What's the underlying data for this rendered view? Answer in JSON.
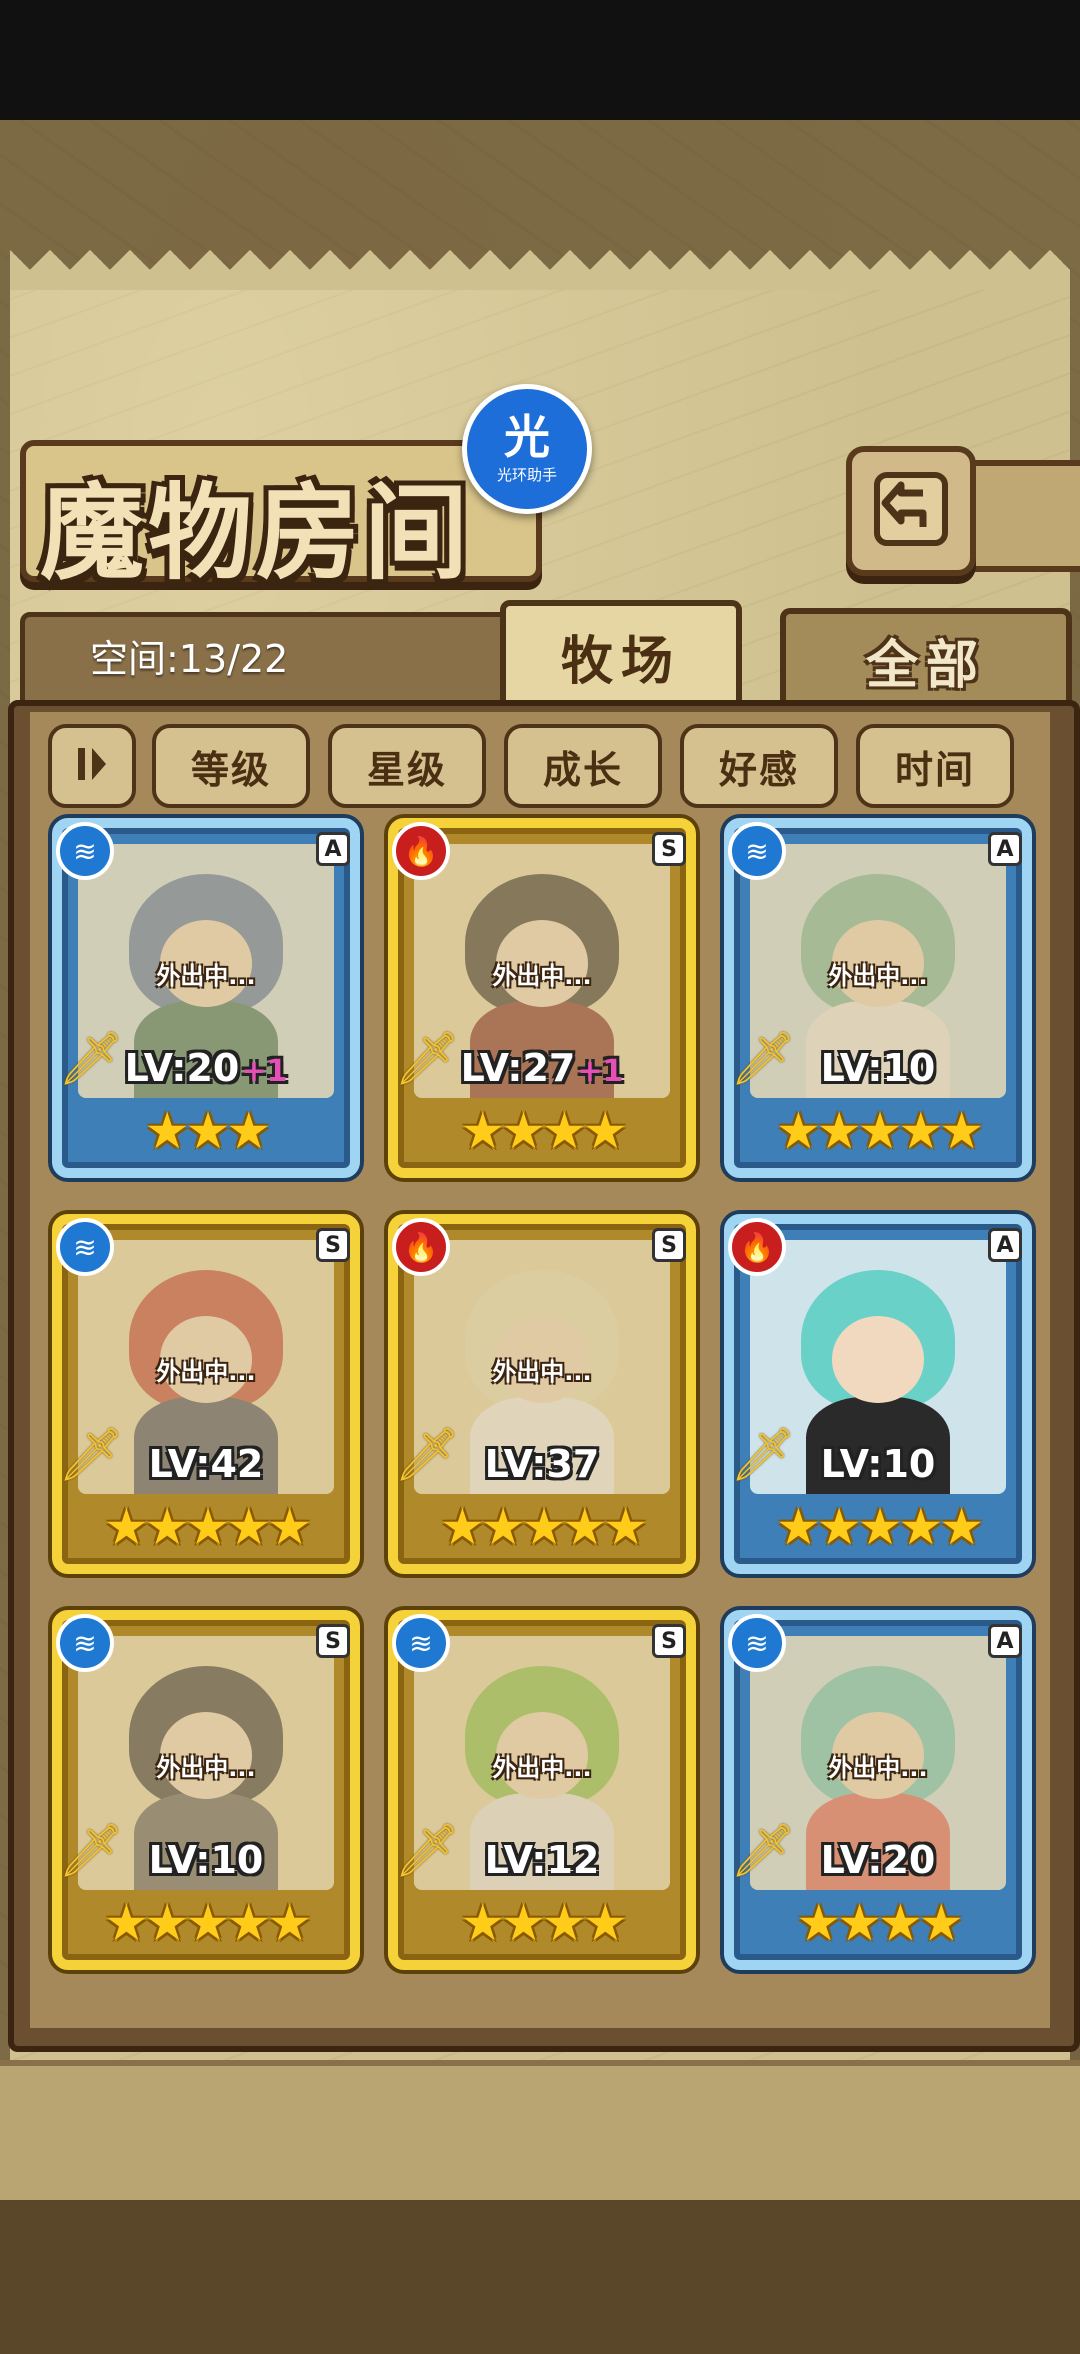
{
  "header": {
    "title": "魔物房间",
    "overlay_badge": {
      "glyph": "光",
      "caption": "光环助手"
    },
    "back_icon": "return-arrow-icon"
  },
  "space": {
    "label": "空间:13/22"
  },
  "tabs": [
    {
      "label": "牧场",
      "active": true
    },
    {
      "label": "全部",
      "active": false
    }
  ],
  "sort": {
    "toggle_icon": "sort-order-icon",
    "buttons": [
      "等级",
      "星级",
      "成长",
      "好感",
      "时间"
    ]
  },
  "status_text": "外出中...",
  "colors": {
    "blue_frame": "#9fd4f2",
    "gold_frame": "#f6d23a",
    "water": "#1f78d1",
    "fire": "#c81e1e",
    "plus": "#e64fb6"
  },
  "cards": [
    {
      "element": "water",
      "rank": "A",
      "frame": "blue",
      "level": "LV:20",
      "bonus": "+1",
      "stars": "★★★",
      "out": true,
      "hair": "#4d6fa8",
      "outfit": "#2f6b5a"
    },
    {
      "element": "fire",
      "rank": "S",
      "frame": "gold",
      "level": "LV:27",
      "bonus": "+1",
      "stars": "★★★★",
      "out": true,
      "hair": "#2b2420",
      "outfit": "#7a1c14"
    },
    {
      "element": "water",
      "rank": "A",
      "frame": "blue",
      "level": "LV:10",
      "bonus": "",
      "stars": "★★★★★",
      "out": true,
      "hair": "#6fb7a0",
      "outfit": "#eeeeee"
    },
    {
      "element": "water",
      "rank": "S",
      "frame": "gold",
      "level": "LV:42",
      "bonus": "",
      "stars": "★★★★★",
      "out": true,
      "hair": "#c0392b",
      "outfit": "#3a3f55"
    },
    {
      "element": "fire",
      "rank": "S",
      "frame": "gold",
      "level": "LV:37",
      "bonus": "",
      "stars": "★★★★★",
      "out": true,
      "hair": "#e9dfb8",
      "outfit": "#f2f2f2"
    },
    {
      "element": "fire",
      "rank": "A",
      "frame": "blue",
      "level": "LV:10",
      "bonus": "",
      "stars": "★★★★★",
      "out": false,
      "hair": "#6ad1c8",
      "outfit": "#2a2a2a"
    },
    {
      "element": "water",
      "rank": "S",
      "frame": "gold",
      "level": "LV:10",
      "bonus": "",
      "stars": "★★★★★",
      "out": true,
      "hair": "#2e2e2e",
      "outfit": "#555555"
    },
    {
      "element": "water",
      "rank": "S",
      "frame": "gold",
      "level": "LV:12",
      "bonus": "",
      "stars": "★★★★",
      "out": true,
      "hair": "#7fbf3f",
      "outfit": "#e8e8e8"
    },
    {
      "element": "water",
      "rank": "A",
      "frame": "blue",
      "level": "LV:20",
      "bonus": "",
      "stars": "★★★★",
      "out": true,
      "hair": "#64c7c0",
      "outfit": "#e05a5a"
    }
  ]
}
